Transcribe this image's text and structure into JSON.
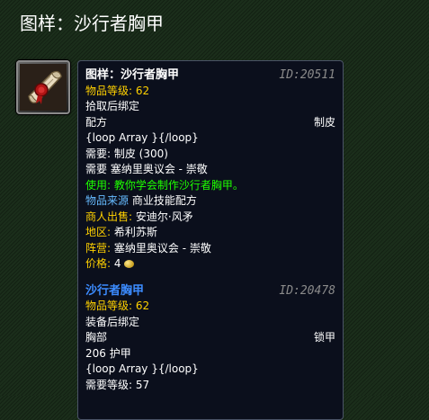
{
  "page": {
    "title": "图样：沙行者胸甲"
  },
  "icon": {
    "name": "recipe-scroll-icon"
  },
  "recipe": {
    "name": "图样：沙行者胸甲",
    "id": "ID:20511",
    "item_level_label": "物品等级:",
    "item_level_value": "62",
    "bind": "拾取后绑定",
    "type_left": "配方",
    "type_right": "制皮",
    "loop_text": "{loop Array }{/loop}",
    "req_skill": "需要: 制皮 (300)",
    "req_rep": "需要 塞纳里奥议会 - 崇敬",
    "use_text": "使用: 教你学会制作沙行者胸甲。",
    "source_label": "物品来源",
    "source_value": "商业技能配方",
    "vendor_label": "商人出售:",
    "vendor_value": "安迪尔·风矛",
    "zone_label": "地区:",
    "zone_value": "希利苏斯",
    "faction_label": "阵营:",
    "faction_value": "塞纳里奥议会 - 崇敬",
    "price_label": "价格:",
    "price_value": "4"
  },
  "item": {
    "name": "沙行者胸甲",
    "id": "ID:20478",
    "item_level_label": "物品等级:",
    "item_level_value": "62",
    "bind": "装备后绑定",
    "slot_left": "胸部",
    "slot_right": "锁甲",
    "armor": "206 护甲",
    "loop_text": "{loop Array }{/loop}",
    "req_level": "需要等级: 57"
  },
  "colors": {
    "background": "#1b2e1b",
    "tooltip_bg": "#0b0f1c",
    "gold": "#ffd100",
    "green": "#1eff00",
    "blue": "#66bbff",
    "item_name": "#3c8cff"
  }
}
